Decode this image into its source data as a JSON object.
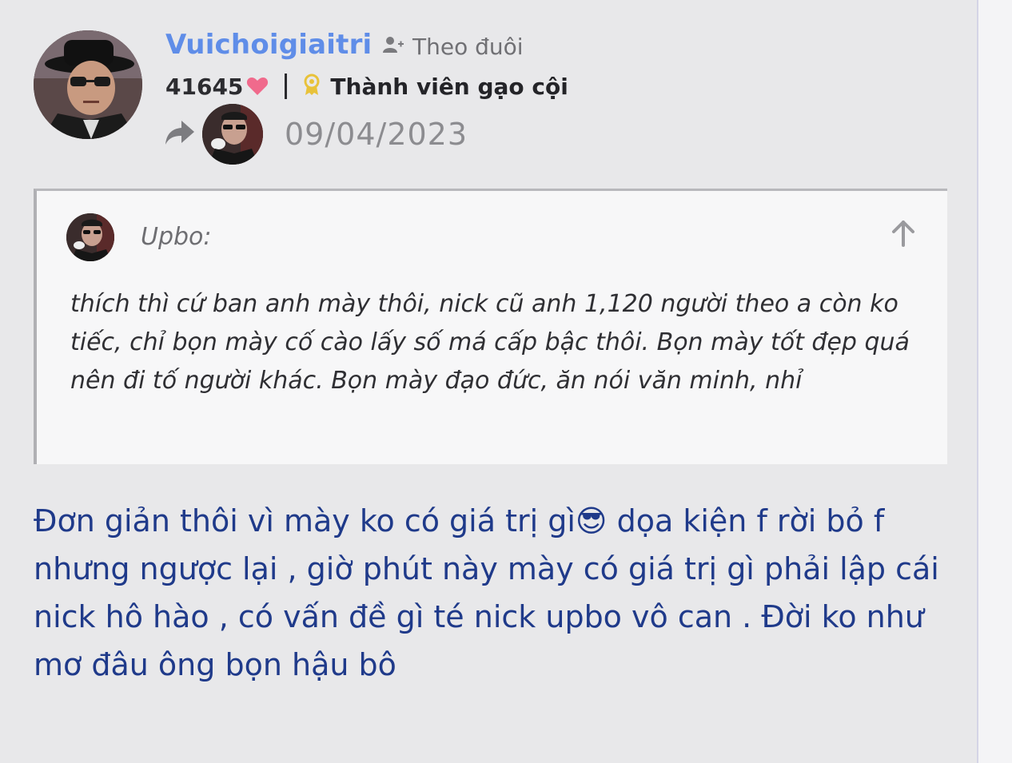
{
  "post": {
    "username": "Vuichoigiaitri",
    "follow_label": "Theo đuôi",
    "points": "41645",
    "rank": "Thành viên gạo cội",
    "date": "09/04/2023",
    "quote": {
      "author": "Upbo:",
      "text": "thích thì cứ ban anh mày thôi, nick cũ anh 1,120 người theo a còn ko tiếc, chỉ bọn mày cố cào lấy số má cấp bậc thôi. Bọn mày tốt đẹp quá nên đi tố người khác. Bọn mày đạo đức, ăn nói văn minh, nhỉ"
    },
    "reply": "Đơn giản thôi vì mày ko có giá trị gì😎 dọa kiện f rời bỏ f nhưng ngược lại , giờ phút này mày có giá trị gì phải lập cái nick hô hào , có vấn đề gì té nick upbo vô can . Đời ko như mơ đâu ông bọn hậu bô"
  },
  "colors": {
    "username": "#5f8de8",
    "heart": "#f06a8c",
    "rank_badge": "#e8c23a",
    "reply_text": "#1f3a8a"
  },
  "icons": {
    "follow": "person-plus-icon",
    "heart": "heart-icon",
    "rank": "award-badge-icon",
    "share": "share-arrow-icon",
    "quote_jump": "arrow-up-icon"
  }
}
